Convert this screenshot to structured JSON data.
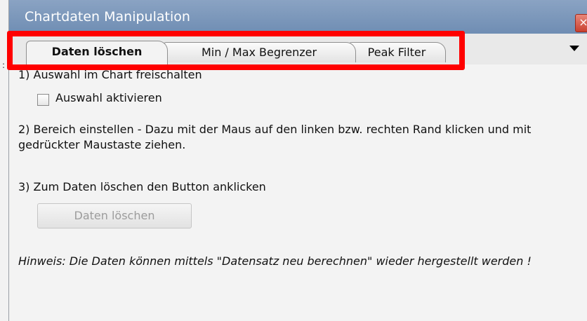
{
  "window": {
    "title": "Chartdaten Manipulation",
    "close_glyph": "×"
  },
  "left_strip": {
    "mark": ":"
  },
  "tabs": [
    {
      "label": "Daten löschen",
      "active": true
    },
    {
      "label": "Min / Max Begrenzer",
      "active": false
    },
    {
      "label": "Peak Filter",
      "active": false
    }
  ],
  "content": {
    "step1": "1) Auswahl im Chart freischalten",
    "checkbox_label": "Auswahl aktivieren",
    "checkbox_checked": false,
    "step2": "2) Bereich einstellen - Dazu mit der Maus auf den linken bzw. rechten Rand klicken und mit gedrückter Maustaste ziehen.",
    "step3": "3) Zum Daten löschen den Button anklicken",
    "button_label": "Daten löschen",
    "hint": "Hinweis: Die Daten können mittels \"Datensatz neu berechnen\" wieder hergestellt werden !"
  },
  "colors": {
    "highlight": "#ff0000",
    "titlebar": "#7a96bb"
  }
}
